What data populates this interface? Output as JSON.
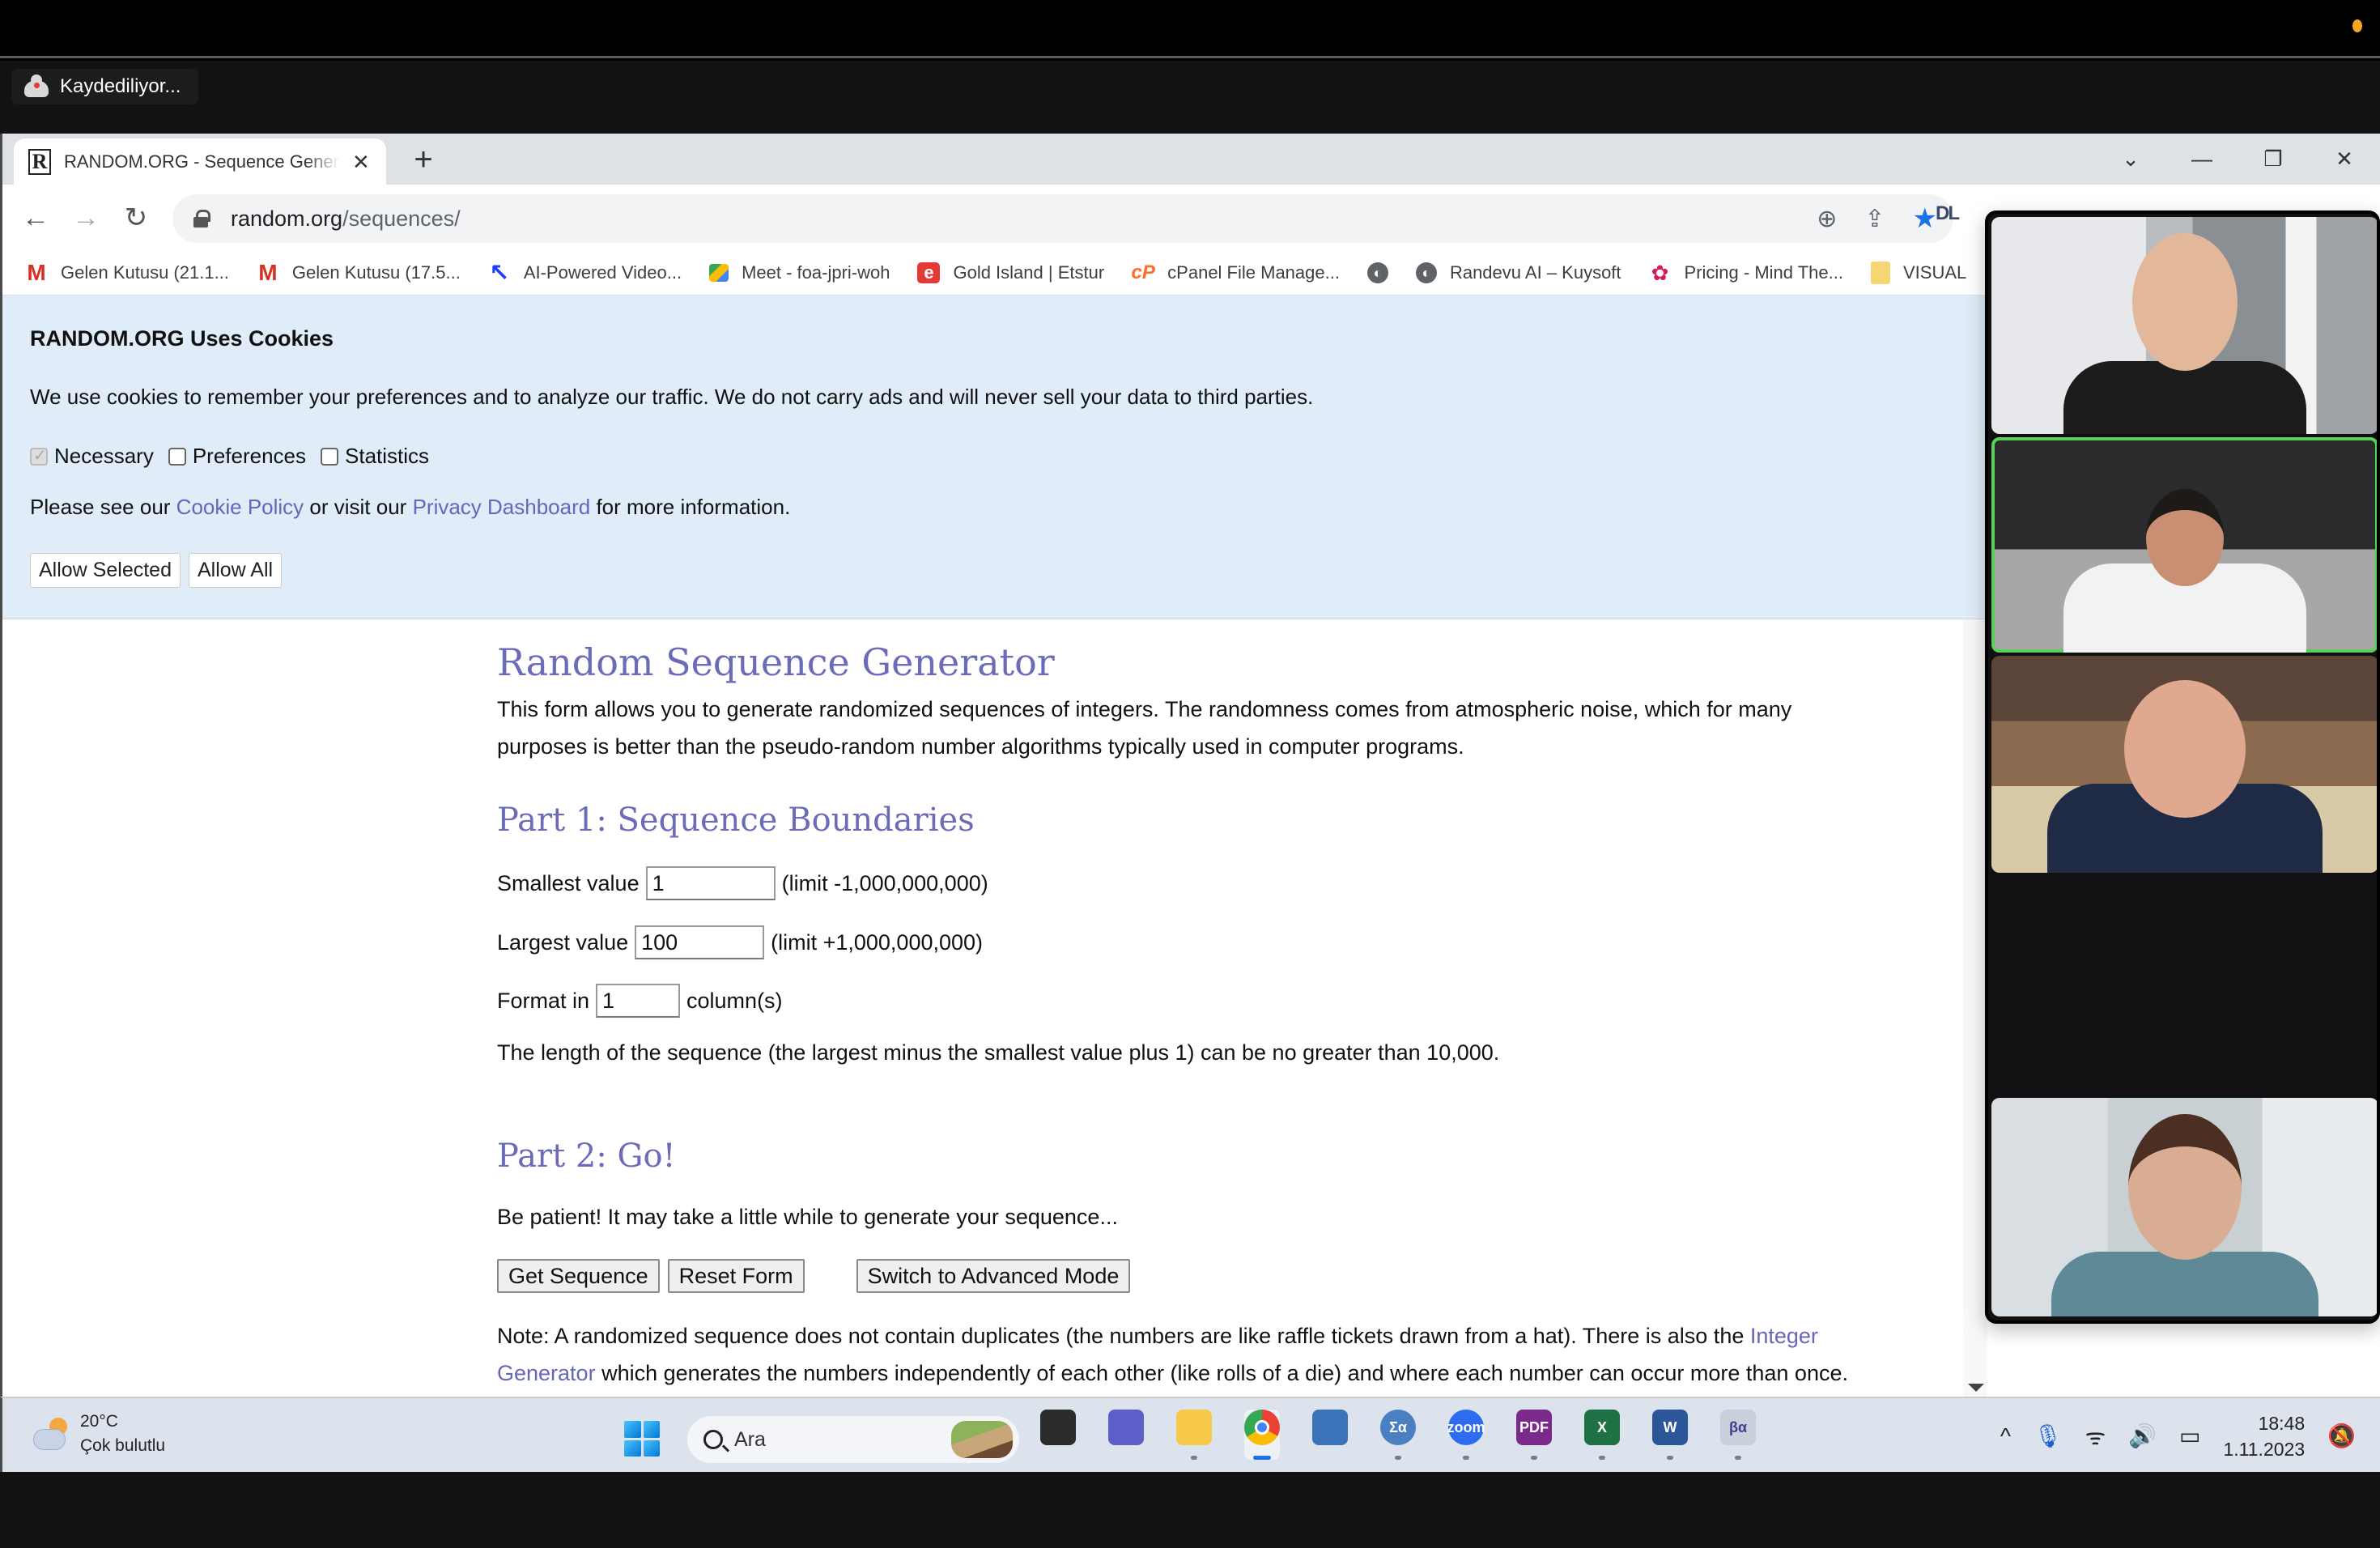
{
  "recording": {
    "label": "Kaydediliyor..."
  },
  "browser": {
    "tab": {
      "title": "RANDOM.ORG - Sequence Generator",
      "favicon": "R"
    },
    "new_tab_label": "+",
    "window_controls": {
      "dropdown": "⌄",
      "minimize": "—",
      "restore": "❐",
      "close": "✕"
    },
    "nav": {
      "back": "←",
      "forward": "→",
      "reload": "↻"
    },
    "url": {
      "host": "random.org",
      "path": "/sequences/"
    },
    "omnibox_icons": {
      "zoom": "⊕",
      "share": "⇪",
      "bookmark": "★"
    },
    "extension_label": "DL",
    "bookmarks": [
      {
        "label": "Gelen Kutusu (21.1...",
        "icon": "gmail-icon",
        "glyph": "M"
      },
      {
        "label": "Gelen Kutusu (17.5...",
        "icon": "gmail-icon",
        "glyph": "M"
      },
      {
        "label": "AI-Powered Video...",
        "icon": "ai-video-icon",
        "glyph": "↖"
      },
      {
        "label": "Meet - foa-jpri-woh",
        "icon": "google-meet-icon",
        "glyph": ""
      },
      {
        "label": "Gold Island | Etstur",
        "icon": "etstur-icon",
        "glyph": "e"
      },
      {
        "label": "cPanel File Manage...",
        "icon": "cpanel-icon",
        "glyph": "cP"
      },
      {
        "label": "",
        "icon": "globe-icon",
        "glyph": "◐"
      },
      {
        "label": "Randevu AI – Kuysoft",
        "icon": "globe-icon",
        "glyph": "◐"
      },
      {
        "label": "Pricing - Mind The...",
        "icon": "brain-icon",
        "glyph": "✿"
      },
      {
        "label": "VISUAL",
        "icon": "folder-icon",
        "glyph": ""
      }
    ]
  },
  "cookie_banner": {
    "title": "RANDOM.ORG Uses Cookies",
    "text": "We use cookies to remember your preferences and to analyze our traffic. We do not carry ads and will never sell your data to third parties.",
    "options": [
      {
        "label": "Necessary",
        "checked": true,
        "disabled": true
      },
      {
        "label": "Preferences",
        "checked": false,
        "disabled": false
      },
      {
        "label": "Statistics",
        "checked": false,
        "disabled": false
      }
    ],
    "info_prefix": "Please see our ",
    "cookie_policy_link": "Cookie Policy",
    "info_middle": " or visit our ",
    "privacy_link": "Privacy Dashboard",
    "info_suffix": " for more information.",
    "allow_selected": "Allow Selected",
    "allow_all": "Allow All"
  },
  "page": {
    "title": "Random Sequence Generator",
    "intro": "This form allows you to generate randomized sequences of integers. The randomness comes from atmospheric noise, which for many purposes is better than the pseudo-random number algorithms typically used in computer programs.",
    "part1_heading": "Part 1: Sequence Boundaries",
    "smallest_label": "Smallest value",
    "smallest_value": "1",
    "smallest_limit": "(limit -1,000,000,000)",
    "largest_label": "Largest value",
    "largest_value": "100",
    "largest_limit": "(limit +1,000,000,000)",
    "format_label": "Format in",
    "format_value": "1",
    "format_suffix": "column(s)",
    "length_note": "The length of the sequence (the largest minus the smallest value plus 1) can be no greater than 10,000.",
    "part2_heading": "Part 2: Go!",
    "patience": "Be patient! It may take a little while to generate your sequence...",
    "get_sequence": "Get Sequence",
    "reset_form": "Reset Form",
    "advanced_mode": "Switch to Advanced Mode",
    "note_prefix": "Note: A randomized sequence does not contain duplicates (the numbers are like raffle tickets drawn from a hat). There is also the ",
    "note_link": "Integer Generator",
    "note_suffix": " which generates the numbers independently of each other (like rolls of a die) and where each number can occur more than once."
  },
  "video_gallery": {
    "tiles": [
      {
        "id": "participant-1",
        "active_speaker": false
      },
      {
        "id": "participant-2",
        "active_speaker": true
      },
      {
        "id": "participant-3",
        "active_speaker": false
      },
      {
        "id": "empty",
        "active_speaker": false
      },
      {
        "id": "participant-4",
        "active_speaker": false
      }
    ],
    "active_color": "#5ad05a"
  },
  "taskbar": {
    "weather": {
      "temp": "20°C",
      "condition": "Çok bulutlu"
    },
    "search_placeholder": "Ara",
    "apps": [
      {
        "name": "task-view",
        "label": "",
        "color": "#2b2b2b",
        "running": false,
        "active": false
      },
      {
        "name": "teams-chat",
        "label": "",
        "color": "#5b5fc7",
        "running": false,
        "active": false
      },
      {
        "name": "file-explorer",
        "label": "",
        "color": "#f7c948",
        "running": true,
        "active": false
      },
      {
        "name": "chrome",
        "label": "",
        "color": "#4285f4",
        "running": true,
        "active": true
      },
      {
        "name": "app-dark",
        "label": "",
        "color": "#3c73b8",
        "running": false,
        "active": false
      },
      {
        "name": "sigma-app",
        "label": "Σα",
        "color": "#4a7fc1",
        "running": true,
        "active": false
      },
      {
        "name": "zoom",
        "label": "zoom",
        "color": "#2d6cf0",
        "running": true,
        "active": false
      },
      {
        "name": "foxit-pdf",
        "label": "PDF",
        "color": "#7b2a8c",
        "running": true,
        "active": false
      },
      {
        "name": "excel",
        "label": "X",
        "color": "#1e7145",
        "running": true,
        "active": false
      },
      {
        "name": "word",
        "label": "W",
        "color": "#2b579a",
        "running": true,
        "active": false
      },
      {
        "name": "beta-alpha-app",
        "label": "βα",
        "color": "#c9d0dc",
        "running": true,
        "active": false
      }
    ],
    "tray": {
      "chevron": "^",
      "mic": "🎙",
      "wifi": "ᯤ",
      "volume": "🔊",
      "battery": "▭"
    },
    "time": "18:48",
    "date": "1.11.2023",
    "notifications": "🔕"
  },
  "colors": {
    "heading": "#6b6bb8",
    "link": "#6666bb",
    "cookie_bg": "#e0ecf7",
    "bookmark_star": "#1a73e8"
  }
}
